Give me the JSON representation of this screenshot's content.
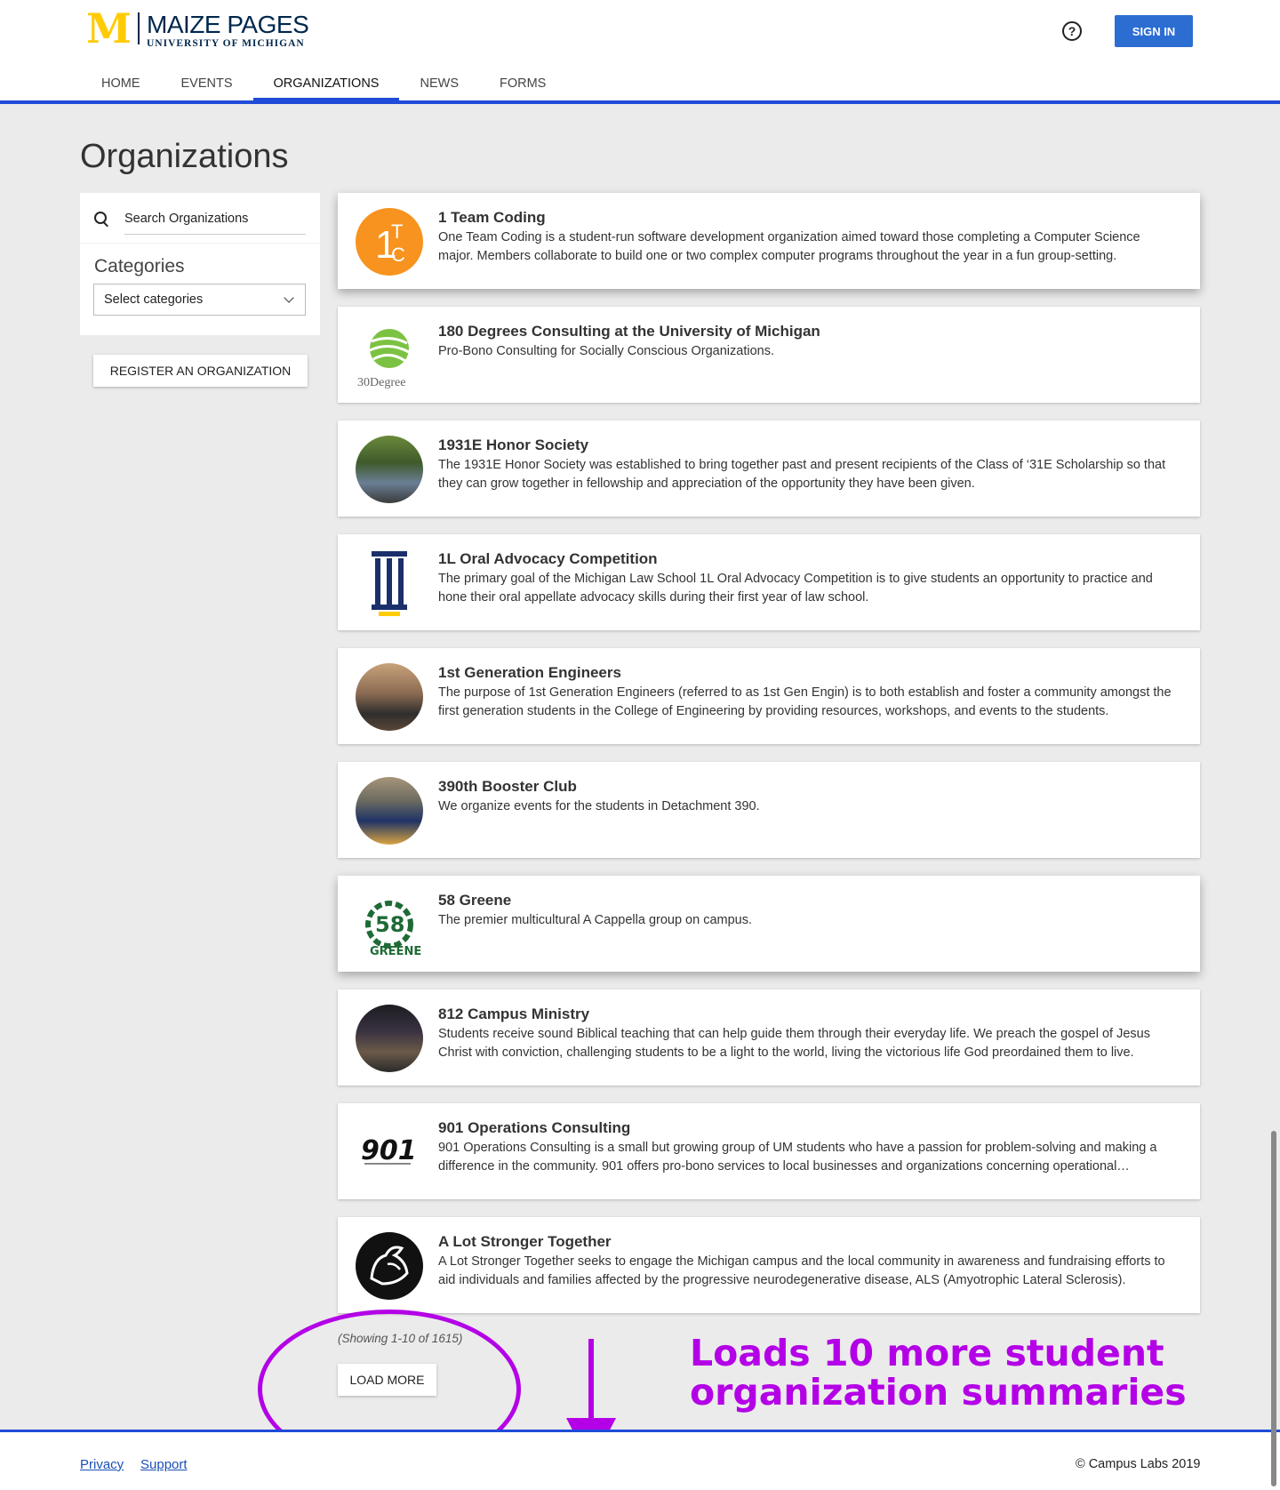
{
  "header": {
    "logo_letter": "M",
    "brand_title": "MAIZE PAGES",
    "brand_subtitle": "UNIVERSITY OF MICHIGAN",
    "help_icon_glyph": "?",
    "sign_in_label": "SIGN IN"
  },
  "nav": {
    "items": [
      {
        "label": "HOME"
      },
      {
        "label": "EVENTS"
      },
      {
        "label": "ORGANIZATIONS"
      },
      {
        "label": "NEWS"
      },
      {
        "label": "FORMS"
      }
    ],
    "active": "ORGANIZATIONS"
  },
  "page_title": "Organizations",
  "filters": {
    "search_placeholder": "Search Organizations",
    "categories_label": "Categories",
    "categories_value": "Select categories",
    "register_label": "REGISTER AN ORGANIZATION"
  },
  "organizations": [
    {
      "name": "1 Team Coding",
      "description": "One Team Coding is a student-run software development organization aimed toward those completing a Computer Science major. Members collaborate to build one or two complex computer programs throughout the year in a fun group-setting.",
      "logo": "1tc-logo",
      "logo_text": "TC"
    },
    {
      "name": "180 Degrees Consulting at the University of Michigan",
      "description": "Pro-Bono Consulting for Socially Conscious Organizations.",
      "logo": "180-degrees-logo",
      "logo_text": "30Degree"
    },
    {
      "name": "1931E Honor Society",
      "description": "The 1931E Honor Society was established to bring together past and present recipients of the Class of ‘31E Scholarship so that they can grow together in fellowship and appreciation of the opportunity they have been given.",
      "logo": "group-photo"
    },
    {
      "name": "1L Oral Advocacy Competition",
      "description": "The primary goal of the Michigan Law School 1L Oral Advocacy Competition is to give students an opportunity to practice and hone their oral appellate advocacy skills during their first year of law school.",
      "logo": "pillar-logo"
    },
    {
      "name": "1st Generation Engineers",
      "description": "The purpose of 1st Generation Engineers (referred to as 1st Gen Engin) is to both establish and foster a community amongst the first generation students in the College of Engineering by providing resources, workshops, and events to the students.",
      "logo": "group-photo"
    },
    {
      "name": "390th Booster Club",
      "description": "We organize events for the students in Detachment 390.",
      "logo": "group-photo"
    },
    {
      "name": "58 Greene",
      "description": "The premier multicultural A Cappella group on campus.",
      "logo": "58-greene-logo"
    },
    {
      "name": "812 Campus Ministry",
      "description": "Students receive sound Biblical teaching that can help guide them through their everyday life. We preach the gospel of Jesus Christ with conviction, challenging students to be a light to the world, living the victorious life God preordained them to live.",
      "logo": "group-photo"
    },
    {
      "name": "901 Operations Consulting",
      "description": "901 Operations Consulting is a small but growing group of UM students who have a passion for problem-solving and making a difference in the community. 901 offers pro-bono services to local businesses and organizations concerning operational…",
      "logo": "901-logo",
      "logo_text": "901"
    },
    {
      "name": "A Lot Stronger Together",
      "description": "A Lot Stronger Together seeks to engage the Michigan campus and the local community in awareness and fundraising efforts to aid individuals and families affected by the progressive neurodegenerative disease, ALS (Amyotrophic Lateral Sclerosis).",
      "logo": "flexed-arm-logo"
    }
  ],
  "pagination": {
    "showing_text": "(Showing 1-10 of 1615)",
    "load_more_label": "LOAD MORE"
  },
  "annotation": {
    "text": "Loads 10 more student organization summaries",
    "color": "#b400e6"
  },
  "footer": {
    "privacy_label": "Privacy",
    "support_label": "Support",
    "copyright": "© Campus Labs 2019"
  },
  "colors": {
    "accent": "#1f4bd8",
    "sign_in": "#2c6dd2",
    "maize": "#ffcb05",
    "navy": "#00274c"
  }
}
